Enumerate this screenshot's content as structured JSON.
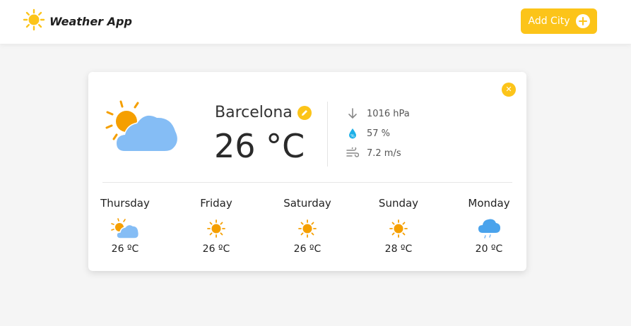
{
  "app": {
    "title": "Weather App"
  },
  "header": {
    "add_city_label": "Add City"
  },
  "card": {
    "city": "Barcelona",
    "temperature": "26 °C",
    "current_icon": "sun-cloud-icon",
    "stats": {
      "pressure": "1016 hPa",
      "humidity": "57 %",
      "wind": "7.2 m/s"
    },
    "forecast": [
      {
        "day": "Thursday",
        "temp": "26 ºC",
        "icon": "sun-cloud-icon"
      },
      {
        "day": "Friday",
        "temp": "26 ºC",
        "icon": "sun-icon"
      },
      {
        "day": "Saturday",
        "temp": "26 ºC",
        "icon": "sun-icon"
      },
      {
        "day": "Sunday",
        "temp": "28 ºC",
        "icon": "sun-icon"
      },
      {
        "day": "Monday",
        "temp": "20 ºC",
        "icon": "rain-cloud-icon"
      }
    ]
  },
  "colors": {
    "accent": "#fcc419",
    "sun": "#fcc419",
    "sun_dark": "#f59f00",
    "cloud": "#85bdf5",
    "rain_cloud": "#4aa3ec",
    "humidity": "#1cb0e8"
  }
}
